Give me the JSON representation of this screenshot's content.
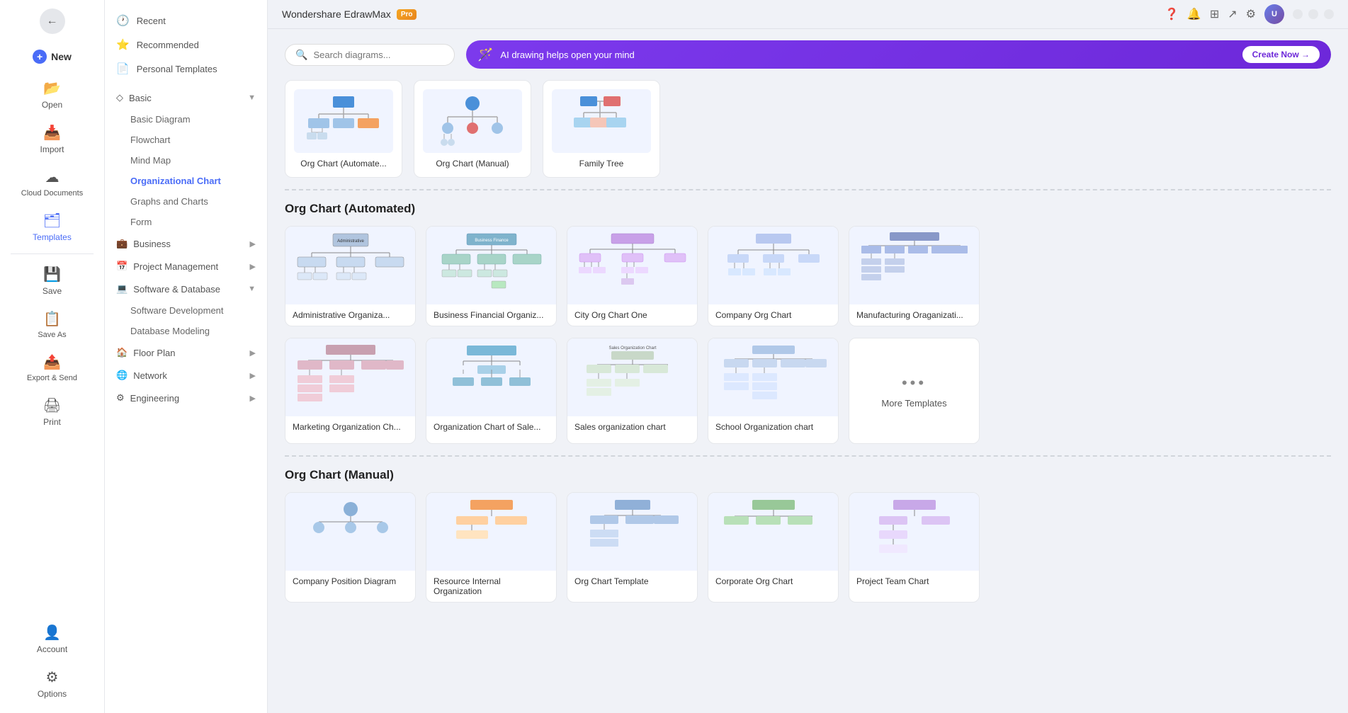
{
  "app": {
    "title": "Wondershare EdrawMax",
    "pro_label": "Pro",
    "window_controls": {
      "minimize": "—",
      "maximize": "❐",
      "close": "✕"
    }
  },
  "sidebar_narrow": {
    "items": [
      {
        "id": "back",
        "icon": "←",
        "label": ""
      },
      {
        "id": "new",
        "icon": "+",
        "label": "New"
      },
      {
        "id": "open",
        "icon": "📂",
        "label": "Open"
      },
      {
        "id": "import",
        "icon": "📥",
        "label": "Import"
      },
      {
        "id": "cloud",
        "icon": "☁",
        "label": "Cloud Documents"
      },
      {
        "id": "templates",
        "icon": "🗂",
        "label": "Templates"
      },
      {
        "id": "save",
        "icon": "💾",
        "label": "Save"
      },
      {
        "id": "saveas",
        "icon": "📋",
        "label": "Save As"
      },
      {
        "id": "export",
        "icon": "📤",
        "label": "Export & Send"
      },
      {
        "id": "print",
        "icon": "🖨",
        "label": "Print"
      },
      {
        "id": "account",
        "icon": "👤",
        "label": "Account"
      },
      {
        "id": "options",
        "icon": "⚙",
        "label": "Options"
      }
    ]
  },
  "sidebar_wide": {
    "top_items": [
      {
        "id": "recent",
        "icon": "🕐",
        "label": "Recent"
      },
      {
        "id": "recommended",
        "icon": "⭐",
        "label": "Recommended"
      },
      {
        "id": "personal",
        "icon": "📄",
        "label": "Personal Templates"
      }
    ],
    "categories": [
      {
        "id": "basic",
        "label": "Basic",
        "icon": "◇",
        "active": true,
        "expanded": true,
        "sub_items": [
          {
            "id": "basic-diagram",
            "label": "Basic Diagram"
          },
          {
            "id": "flowchart",
            "label": "Flowchart"
          },
          {
            "id": "mind-map",
            "label": "Mind Map"
          },
          {
            "id": "org-chart",
            "label": "Organizational Chart",
            "active": true
          }
        ]
      },
      {
        "id": "graphs",
        "label": "Graphs and Charts",
        "icon": "📊",
        "sub": true,
        "indent": true
      },
      {
        "id": "form",
        "label": "Form",
        "icon": "📝",
        "sub": true,
        "indent": true
      },
      {
        "id": "business",
        "label": "Business",
        "icon": "💼",
        "has_arrow": true
      },
      {
        "id": "project",
        "label": "Project Management",
        "icon": "📅",
        "has_arrow": true
      },
      {
        "id": "software",
        "label": "Software & Database",
        "icon": "💻",
        "has_arrow": true,
        "expanded": true
      },
      {
        "id": "software-dev",
        "label": "Software Development",
        "indent": true
      },
      {
        "id": "db-modeling",
        "label": "Database Modeling",
        "indent": true
      },
      {
        "id": "floor",
        "label": "Floor Plan",
        "icon": "🏠",
        "has_arrow": true
      },
      {
        "id": "network",
        "label": "Network",
        "icon": "🌐",
        "has_arrow": true
      },
      {
        "id": "engineering",
        "label": "Engineering",
        "icon": "⚙",
        "has_arrow": true
      }
    ]
  },
  "top_tools": {
    "search_placeholder": "Search diagrams...",
    "ai_banner_text": "AI drawing helps open your mind",
    "create_now_label": "Create Now →"
  },
  "top_templates": [
    {
      "id": "org-auto",
      "label": "Org Chart (Automate...",
      "type": "org_auto"
    },
    {
      "id": "org-manual",
      "label": "Org Chart (Manual)",
      "type": "org_manual"
    },
    {
      "id": "family-tree",
      "label": "Family Tree",
      "type": "family_tree"
    }
  ],
  "sections": [
    {
      "id": "org-chart-automated",
      "title": "Org Chart (Automated)",
      "templates": [
        {
          "id": "admin-org",
          "label": "Administrative Organiza..."
        },
        {
          "id": "biz-fin-org",
          "label": "Business Financial Organiz..."
        },
        {
          "id": "city-org",
          "label": "City Org Chart One"
        },
        {
          "id": "company-org",
          "label": "Company Org Chart"
        },
        {
          "id": "mfg-org",
          "label": "Manufacturing Oraganizati..."
        },
        {
          "id": "marketing-org",
          "label": "Marketing Organization Ch..."
        },
        {
          "id": "sales-chart-org",
          "label": "Organization Chart of Sale..."
        },
        {
          "id": "sales-org",
          "label": "Sales organization chart"
        },
        {
          "id": "school-org",
          "label": "School Organization chart"
        },
        {
          "id": "more-templates",
          "label": "More Templates",
          "is_more": true
        }
      ]
    },
    {
      "id": "org-chart-manual",
      "title": "Org Chart (Manual)",
      "templates": []
    }
  ]
}
